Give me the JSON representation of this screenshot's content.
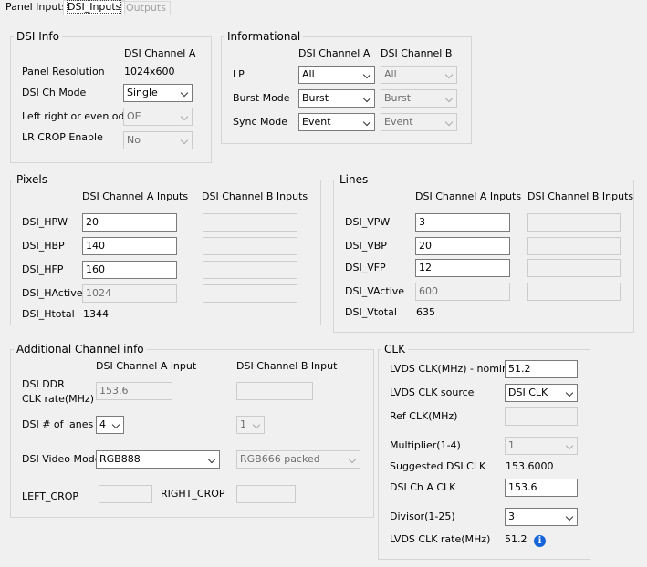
{
  "tabs": [
    "Panel Inputs",
    "DSI_Inputs",
    "Outputs"
  ],
  "dsi_info": {
    "title": "DSI Info",
    "col_a": "DSI Channel A",
    "panel_resolution_label": "Panel Resolution",
    "panel_resolution_value": "1024x600",
    "ch_mode_label": "DSI Ch Mode",
    "ch_mode_value": "Single",
    "lr_label": "Left right or even odd",
    "lr_value": "OE",
    "lr_crop_label": "LR CROP Enable",
    "lr_crop_value": "No"
  },
  "informational": {
    "title": "Informational",
    "col_a": "DSI Channel A",
    "col_b": "DSI Channel B",
    "lp_label": "LP",
    "lp_a": "All",
    "lp_b": "All",
    "burst_label": "Burst Mode",
    "burst_a": "Burst",
    "burst_b": "Burst",
    "sync_label": "Sync Mode",
    "sync_a": "Event",
    "sync_b": "Event"
  },
  "pixels": {
    "title": "Pixels",
    "col_a": "DSI Channel A Inputs",
    "col_b": "DSI Channel B Inputs",
    "hpw_label": "DSI_HPW",
    "hpw_a": "20",
    "hpw_b": "",
    "hbp_label": "DSI_HBP",
    "hbp_a": "140",
    "hbp_b": "",
    "hfp_label": "DSI_HFP",
    "hfp_a": "160",
    "hfp_b": "",
    "hactive_label": "DSI_HActive",
    "hactive_a": "1024",
    "hactive_b": "",
    "htotal_label": "DSI_Htotal",
    "htotal_value": "1344"
  },
  "lines": {
    "title": "Lines",
    "col_a": "DSI Channel A Inputs",
    "col_b": "DSI Channel B Inputs",
    "vpw_label": "DSI_VPW",
    "vpw_a": "3",
    "vpw_b": "",
    "vbp_label": "DSI_VBP",
    "vbp_a": "20",
    "vbp_b": "",
    "vfp_label": "DSI_VFP",
    "vfp_a": "12",
    "vfp_b": "",
    "vactive_label": "DSI_VActive",
    "vactive_a": "600",
    "vactive_b": "",
    "vtotal_label": "DSI_Vtotal",
    "vtotal_value": "635"
  },
  "additional": {
    "title": "Additional Channel info",
    "col_a": "DSI Channel A input",
    "col_b": "DSI Channel B Input",
    "ddr_label_1": "DSI DDR",
    "ddr_label_2": "CLK rate(MHz)",
    "ddr_a": "153.6",
    "ddr_b": "",
    "lanes_label": "DSI # of lanes",
    "lanes_a": "4",
    "lanes_b": "1",
    "video_label": "DSI Video Mode",
    "video_a": "RGB888",
    "video_b": "RGB666 packed",
    "left_crop_label": "LEFT_CROP",
    "left_crop_value": "",
    "right_crop_label": "RIGHT_CROP",
    "right_crop_value": ""
  },
  "clk": {
    "title": "CLK",
    "lvds_nominal_label": "LVDS CLK(MHz) - nominal",
    "lvds_nominal_value": "51.2",
    "lvds_source_label": "LVDS CLK source",
    "lvds_source_value": "DSI CLK",
    "ref_label": "Ref CLK(MHz)",
    "ref_value": "",
    "multiplier_label": "Multiplier(1-4)",
    "multiplier_value": "1",
    "suggested_label": "Suggested DSI CLK",
    "suggested_value": "153.6000",
    "ch_a_clk_label": "DSI Ch A CLK",
    "ch_a_clk_value": "153.6",
    "divisor_label": "Divisor(1-25)",
    "divisor_value": "3",
    "lvds_rate_label": "LVDS CLK rate(MHz)",
    "lvds_rate_value": "51.2"
  },
  "icons": {
    "info": "info-icon"
  },
  "colors": {
    "accent": "#1565d8",
    "background": "#f0f0f0",
    "border": "#d5d5d5"
  }
}
